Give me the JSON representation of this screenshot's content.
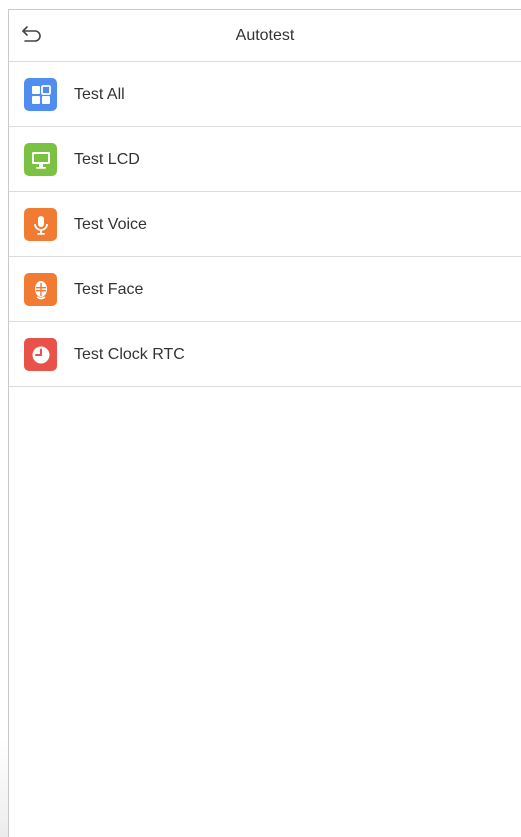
{
  "header": {
    "title": "Autotest"
  },
  "menu": {
    "items": [
      {
        "label": "Test All",
        "icon": "grid-icon",
        "color": "#4f8ef0"
      },
      {
        "label": "Test LCD",
        "icon": "monitor-icon",
        "color": "#7cc242"
      },
      {
        "label": "Test Voice",
        "icon": "microphone-icon",
        "color": "#f27b33"
      },
      {
        "label": "Test Face",
        "icon": "face-icon",
        "color": "#f27b33"
      },
      {
        "label": "Test Clock RTC",
        "icon": "clock-icon",
        "color": "#e9524a"
      }
    ]
  },
  "colors": {
    "divider": "#dcdcdc",
    "text": "#333333"
  }
}
